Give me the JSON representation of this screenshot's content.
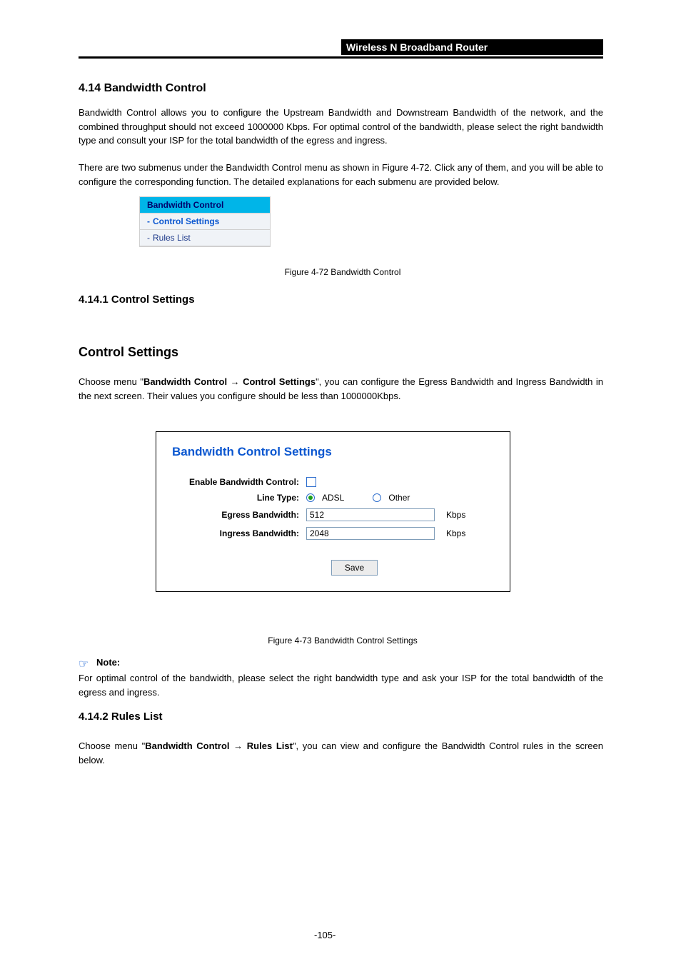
{
  "header": {
    "product": "Wireless N Broadband Router"
  },
  "section1": {
    "heading": "4.14 Bandwidth Control",
    "para1": "Bandwidth Control allows you to configure the Upstream Bandwidth and Downstream Bandwidth of the network, and the combined throughput should not exceed 1000000 Kbps. For optimal control of the bandwidth, please select the right bandwidth type and consult your ISP for the total bandwidth of the egress and ingress.",
    "para2_a": "There are two submenus under the Bandwidth Control menu as shown in Figure 4-72. Click any of them, and you will be able to configure the corresponding function. The detailed explanations for each submenu are provided below."
  },
  "menu": {
    "title": "Bandwidth Control",
    "item1": "Control Settings",
    "item2": "Rules List"
  },
  "caption1": "Figure 4-72 Bandwidth Control",
  "section2": {
    "heading": "4.14.1 Control Settings",
    "para_a": "Choose menu \"",
    "para_b": "Bandwidth Control ",
    "para_arrow": "→",
    "para_c": " Control Settings",
    "para_d": "\", you can configure the Egress Bandwidth and Ingress Bandwidth in the next screen. Their values you configure should be less than 1000000Kbps."
  },
  "panel": {
    "title": "Bandwidth Control Settings",
    "enable_label": "Enable Bandwidth Control:",
    "line_type_label": "Line Type:",
    "adsl": "ADSL",
    "other": "Other",
    "egress_label": "Egress Bandwidth:",
    "egress_value": "512",
    "ingress_label": "Ingress Bandwidth:",
    "ingress_value": "2048",
    "unit": "Kbps",
    "save": "Save"
  },
  "caption2": "Figure 4-73 Bandwidth Control Settings",
  "note": {
    "label": "Note:",
    "text": "For optimal control of the bandwidth, please select the right bandwidth type and ask your ISP for the total bandwidth of the egress and ingress."
  },
  "section3": {
    "heading": "4.14.2 Rules List",
    "para_a": "Choose menu \"",
    "para_b": "Bandwidth Control ",
    "para_arrow": "→",
    "para_c": " Rules List",
    "para_d": "\", you can view and configure the Bandwidth Control rules in the screen below."
  },
  "page_number": "-105-"
}
